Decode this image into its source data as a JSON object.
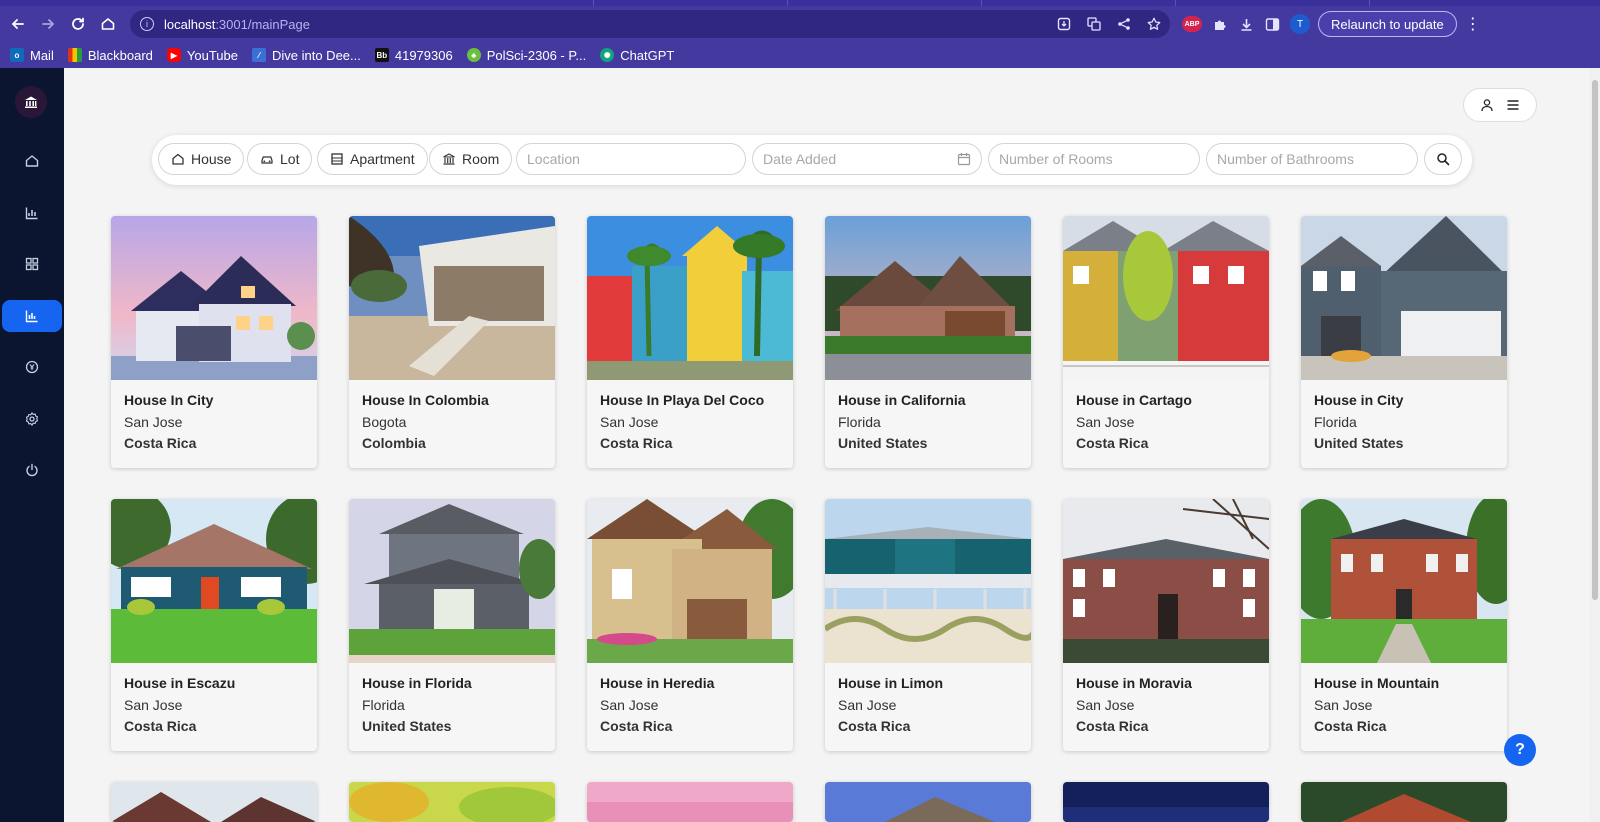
{
  "browser": {
    "url_host": "localhost",
    "url_path": ":3001/mainPage",
    "relaunch_label": "Relaunch to update",
    "profile_initial": "T",
    "abp_label": "ABP"
  },
  "bookmarks": [
    {
      "label": "Mail",
      "icon": "outlook-icon",
      "color": "#0f6cbd"
    },
    {
      "label": "Blackboard",
      "icon": "blackboard-icon",
      "color": "#222222"
    },
    {
      "label": "YouTube",
      "icon": "youtube-icon",
      "color": "#ff0000"
    },
    {
      "label": "Dive into Dee...",
      "icon": "d2l-icon",
      "color": "#3b6fd8"
    },
    {
      "label": "41979306",
      "icon": "bb-icon",
      "color": "#111111"
    },
    {
      "label": "PolSci-2306 - P...",
      "icon": "clover-icon",
      "color": "#6cbf3a"
    },
    {
      "label": "ChatGPT",
      "icon": "chatgpt-icon",
      "color": "#10a37f"
    }
  ],
  "filters": {
    "chips": [
      "House",
      "Lot",
      "Apartment",
      "Room"
    ],
    "location_placeholder": "Location",
    "date_placeholder": "Date Added",
    "rooms_placeholder": "Number of Rooms",
    "bathrooms_placeholder": "Number of Bathrooms"
  },
  "listings": [
    {
      "title": "House In City",
      "city": "San Jose",
      "country": "Costa Rica"
    },
    {
      "title": "House In Colombia",
      "city": "Bogota",
      "country": "Colombia"
    },
    {
      "title": "House In Playa Del Coco",
      "city": "San Jose",
      "country": "Costa Rica"
    },
    {
      "title": "House in California",
      "city": "Florida",
      "country": "United States"
    },
    {
      "title": "House in Cartago",
      "city": "San Jose",
      "country": "Costa Rica"
    },
    {
      "title": "House in City",
      "city": "Florida",
      "country": "United States"
    },
    {
      "title": "House in Escazu",
      "city": "San Jose",
      "country": "Costa Rica"
    },
    {
      "title": "House in Florida",
      "city": "Florida",
      "country": "United States"
    },
    {
      "title": "House in Heredia",
      "city": "San Jose",
      "country": "Costa Rica"
    },
    {
      "title": "House in Limon",
      "city": "San Jose",
      "country": "Costa Rica"
    },
    {
      "title": "House in Moravia",
      "city": "San Jose",
      "country": "Costa Rica"
    },
    {
      "title": "House in Mountain",
      "city": "San Jose",
      "country": "Costa Rica"
    }
  ],
  "help_label": "?"
}
